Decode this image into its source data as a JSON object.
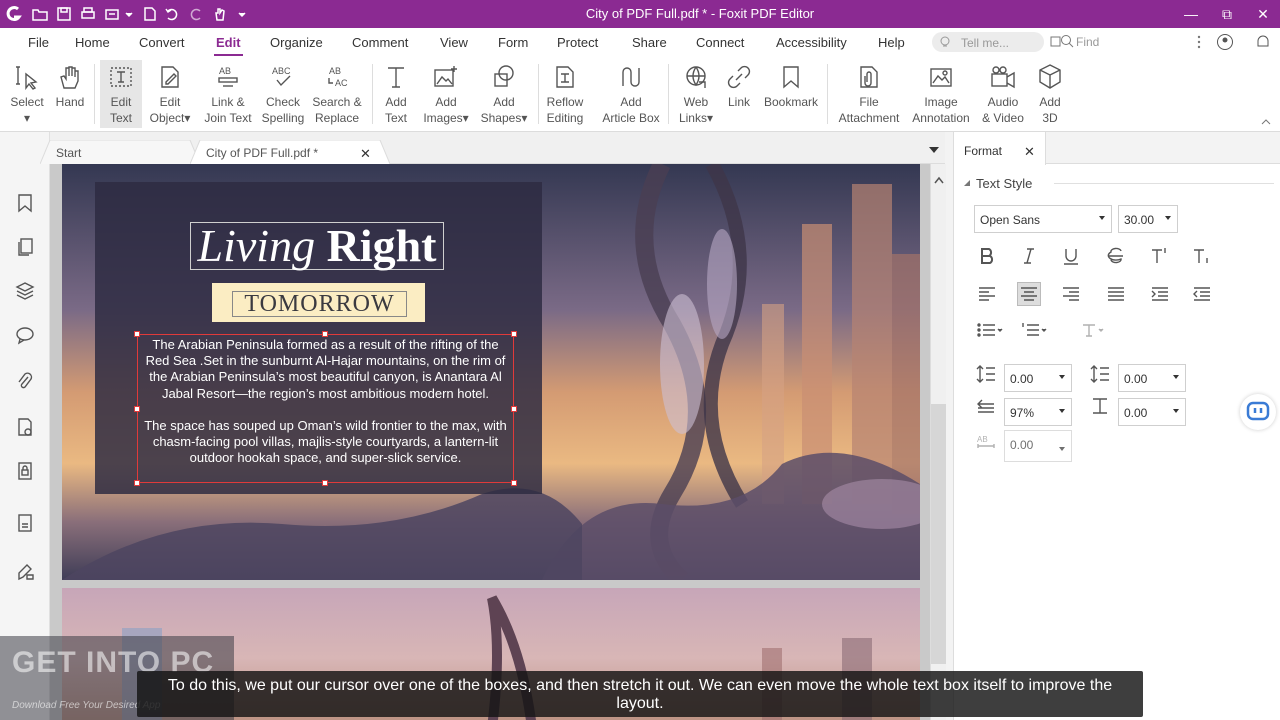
{
  "window": {
    "title": "City of PDF Full.pdf * - Foxit PDF Editor",
    "minimize": "—",
    "restore": "⧉",
    "close": "✕"
  },
  "menu": {
    "tabs": [
      "File",
      "Home",
      "Convert",
      "Edit",
      "Organize",
      "Comment",
      "View",
      "Form",
      "Protect",
      "Share",
      "Connect",
      "Accessibility",
      "Help"
    ],
    "active": "Edit",
    "tell_me": "Tell me...",
    "find": "Find"
  },
  "ribbon": {
    "buttons": [
      {
        "label": "Select\n▾",
        "icon": "select-cursor-icon"
      },
      {
        "label": "Hand",
        "icon": "hand-icon"
      },
      {
        "label": "Edit\nText",
        "icon": "edit-text-icon"
      },
      {
        "label": "Edit\nObject▾",
        "icon": "edit-object-icon"
      },
      {
        "label": "Link &\nJoin Text",
        "icon": "link-join-text-icon"
      },
      {
        "label": "Check\nSpelling",
        "icon": "check-spelling-icon"
      },
      {
        "label": "Search &\nReplace",
        "icon": "search-replace-icon"
      },
      {
        "label": "Add\nText",
        "icon": "add-text-icon"
      },
      {
        "label": "Add\nImages▾",
        "icon": "add-images-icon"
      },
      {
        "label": "Add\nShapes▾",
        "icon": "add-shapes-icon"
      },
      {
        "label": "Reflow\nEditing",
        "icon": "reflow-editing-icon"
      },
      {
        "label": "Add\nArticle Box",
        "icon": "article-box-icon"
      },
      {
        "label": "Web\nLinks▾",
        "icon": "web-links-icon"
      },
      {
        "label": "Link",
        "icon": "link-icon"
      },
      {
        "label": "Bookmark",
        "icon": "bookmark-icon"
      },
      {
        "label": "File\nAttachment",
        "icon": "file-attachment-icon"
      },
      {
        "label": "Image\nAnnotation",
        "icon": "image-annotation-icon"
      },
      {
        "label": "Audio\n& Video",
        "icon": "audio-video-icon"
      },
      {
        "label": "Add\n3D",
        "icon": "add-3d-icon"
      }
    ]
  },
  "doc_tabs": {
    "start": "Start",
    "current": "City of PDF Full.pdf *",
    "close": "✕"
  },
  "document": {
    "title_italic": "Living",
    "title_bold": "Right",
    "subtitle": "TOMORROW",
    "paragraph1": "The Arabian Peninsula formed as a result of the rifting of the Red Sea .Set in the sunburnt Al-Hajar mountains, on the rim of the Arabian Peninsula’s most beautiful canyon, is Anantara Al Jabal Resort—the region’s most ambitious modern hotel.",
    "paragraph2": "The space has souped up Oman’s wild frontier to the max, with chasm-facing pool villas, majlis-style courtyards, a lantern-lit outdoor hookah space, and super-slick service."
  },
  "format_panel": {
    "tab": "Format",
    "close": "✕",
    "section": "Text Style",
    "font": "Open Sans",
    "size": "30.00",
    "line_spacing": "0.00",
    "para_spacing": "0.00",
    "char_scale": "97%",
    "char_spacing": "0.00",
    "word_spacing": "0.00"
  },
  "caption": "To do this, we put our cursor over one of the boxes, and then stretch it out. We can even move the whole text box itself to improve the layout.",
  "watermark": {
    "big": "GET INTO PC",
    "small": "Download Free Your Desired App"
  },
  "colors": {
    "accent": "#8b2a92",
    "selection": "#e03a3a"
  }
}
